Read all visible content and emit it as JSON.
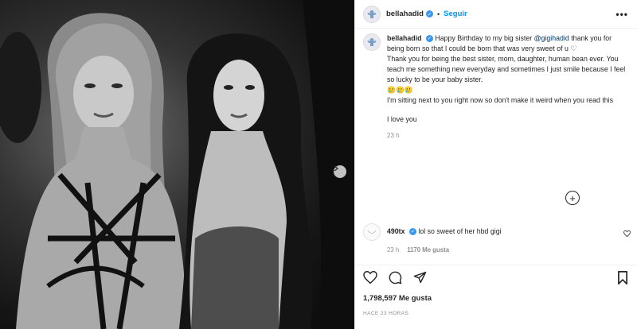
{
  "post": {
    "username": "bellahadid",
    "follow_label": "Seguir",
    "more_label": "•••",
    "dot": "•",
    "verified_icon": "verified-badge-icon"
  },
  "caption": {
    "username": "bellahadid",
    "line1_prefix": "Happy Birthday to my big sister",
    "mention": "@gigihadid",
    "line1_suffix": "thank you for being born so that I could be born that was very sweet of u ♡",
    "paragraph2": "Thank you for being the best sister, mom, daughter, human bean ever. You teach me something new everyday and sometimes I just smile because I feel so lucky to be your baby sister.",
    "emoji": "🥲🥲🥲",
    "paragraph3": "I'm sitting next to you right now so don't make it weird when you read this",
    "paragraph4": "I love you",
    "time": "23 h"
  },
  "load_more": {
    "icon": "plus-circle-icon",
    "label": "+"
  },
  "comment": {
    "username": "490tx",
    "text": "lol so sweet of her hbd gigi",
    "time": "23 h",
    "likes": "1170 Me gusta"
  },
  "actions": {
    "likes_count": "1,798,597 Me gusta",
    "post_time": "HACE 23 HORAS"
  },
  "colors": {
    "accent": "#0095f6",
    "verified": "#3897f0",
    "muted": "#8e8e8e"
  }
}
